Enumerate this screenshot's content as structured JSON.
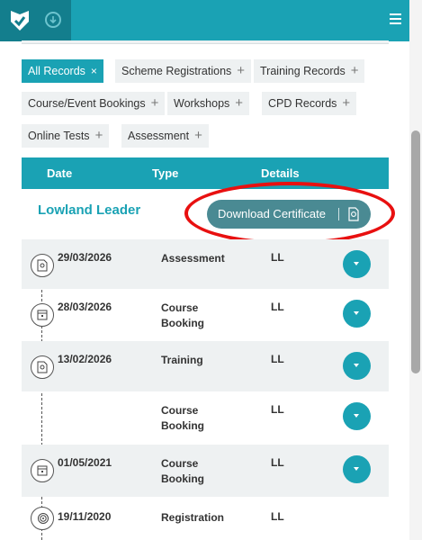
{
  "header": {
    "logo_icon": "shield-check-icon",
    "download_icon": "download-circle-icon",
    "menu_icon": "hamburger-icon",
    "accent_color": "#1aa2b4"
  },
  "filters": {
    "chips": [
      {
        "label": "All Records",
        "action": "×",
        "active": true
      },
      {
        "label": "Scheme Registrations",
        "action": "+",
        "active": false
      },
      {
        "label": "Training Records",
        "action": "+",
        "active": false
      },
      {
        "label": "Course/Event Bookings",
        "action": "+",
        "active": false
      },
      {
        "label": "Workshops",
        "action": "+",
        "active": false
      },
      {
        "label": "CPD Records",
        "action": "+",
        "active": false
      },
      {
        "label": "Online Tests",
        "action": "+",
        "active": false
      },
      {
        "label": "Assessment",
        "action": "+",
        "active": false
      }
    ]
  },
  "table": {
    "columns": [
      "Date",
      "Type",
      "Details"
    ],
    "section_title": "Lowland Leader",
    "download_label": "Download Certificate",
    "rows": [
      {
        "date": "29/03/2026",
        "type": "Assessment",
        "details": "LL",
        "icon": "certificate-icon",
        "expandable": true
      },
      {
        "date": "28/03/2026",
        "type": "Course Booking",
        "details": "LL",
        "icon": "calendar-icon",
        "expandable": true
      },
      {
        "date": "13/02/2026",
        "type": "Training",
        "details": "LL",
        "icon": "certificate-icon",
        "expandable": true
      },
      {
        "date": "",
        "type": "Course Booking",
        "details": "LL",
        "icon": "",
        "expandable": true
      },
      {
        "date": "01/05/2021",
        "type": "Course Booking",
        "details": "LL",
        "icon": "calendar-icon",
        "expandable": true
      },
      {
        "date": "19/11/2020",
        "type": "Registration",
        "details": "LL",
        "icon": "fingerprint-icon",
        "expandable": false
      }
    ]
  }
}
